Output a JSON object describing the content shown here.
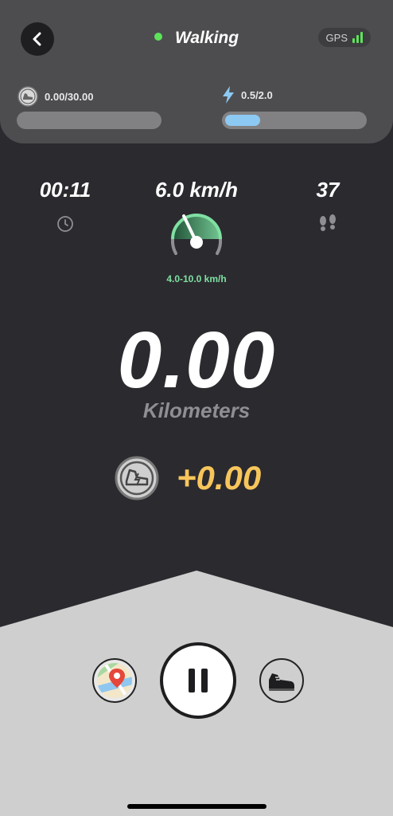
{
  "header": {
    "back_icon": "chevron-left-icon",
    "mode_label": "Walking",
    "mode_status_color": "#5de35a",
    "gps_label": "GPS",
    "gps_signal_icon": "signal-bars-icon"
  },
  "progress": {
    "coin": {
      "icon": "shoe-coin-icon",
      "label": "0.00/30.00",
      "fraction": 0.0
    },
    "energy": {
      "icon": "lightning-icon",
      "label": "0.5/2.0",
      "fraction": 0.25
    }
  },
  "metrics": {
    "time": {
      "value": "00:11",
      "icon": "clock-icon"
    },
    "speed": {
      "value": "6.0 km/h",
      "icon": "speedometer-icon",
      "range": "4.0-10.0 km/h"
    },
    "steps": {
      "value": "37",
      "icon": "footprints-icon"
    }
  },
  "distance": {
    "value": "0.00",
    "unit": "Kilometers"
  },
  "reward": {
    "icon": "shoe-coin-icon",
    "value": "+0.00",
    "color": "#f7c65b"
  },
  "controls": {
    "map_icon": "map-pin-icon",
    "pause_icon": "pause-icon",
    "shoe_icon": "sneaker-icon"
  }
}
